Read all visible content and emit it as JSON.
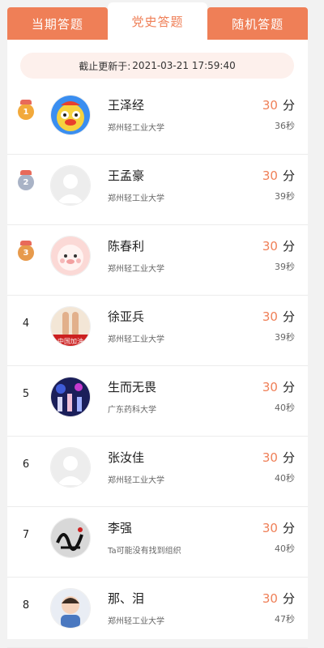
{
  "tabs": [
    {
      "label": "当期答题",
      "active": false
    },
    {
      "label": "党史答题",
      "active": true
    },
    {
      "label": "随机答题",
      "active": false
    }
  ],
  "update": {
    "label": "截止更新于:",
    "time": "2021-03-21 17:59:40"
  },
  "ranking": [
    {
      "rank": "1",
      "medal": "gold",
      "name": "王泽经",
      "school": "郑州轻工业大学",
      "score": "30",
      "unit": "分",
      "time": "36秒",
      "avatar": "cartoon"
    },
    {
      "rank": "2",
      "medal": "silver",
      "name": "王孟豪",
      "school": "郑州轻工业大学",
      "score": "30",
      "unit": "分",
      "time": "39秒",
      "avatar": "default"
    },
    {
      "rank": "3",
      "medal": "bronze",
      "name": "陈春利",
      "school": "郑州轻工业大学",
      "score": "30",
      "unit": "分",
      "time": "39秒",
      "avatar": "pig"
    },
    {
      "rank": "4",
      "medal": "",
      "name": "徐亚兵",
      "school": "郑州轻工业大学",
      "score": "30",
      "unit": "分",
      "time": "39秒",
      "avatar": "fingers"
    },
    {
      "rank": "5",
      "medal": "",
      "name": "生而无畏",
      "school": "广东药科大学",
      "score": "30",
      "unit": "分",
      "time": "40秒",
      "avatar": "stage"
    },
    {
      "rank": "6",
      "medal": "",
      "name": "张汝佳",
      "school": "郑州轻工业大学",
      "score": "30",
      "unit": "分",
      "time": "40秒",
      "avatar": "default"
    },
    {
      "rank": "7",
      "medal": "",
      "name": "李强",
      "school": "Ta可能没有找到组织",
      "score": "30",
      "unit": "分",
      "time": "40秒",
      "avatar": "calligraphy"
    },
    {
      "rank": "8",
      "medal": "",
      "name": "那、泪",
      "school": "郑州轻工业大学",
      "score": "30",
      "unit": "分",
      "time": "47秒",
      "avatar": "child"
    }
  ]
}
